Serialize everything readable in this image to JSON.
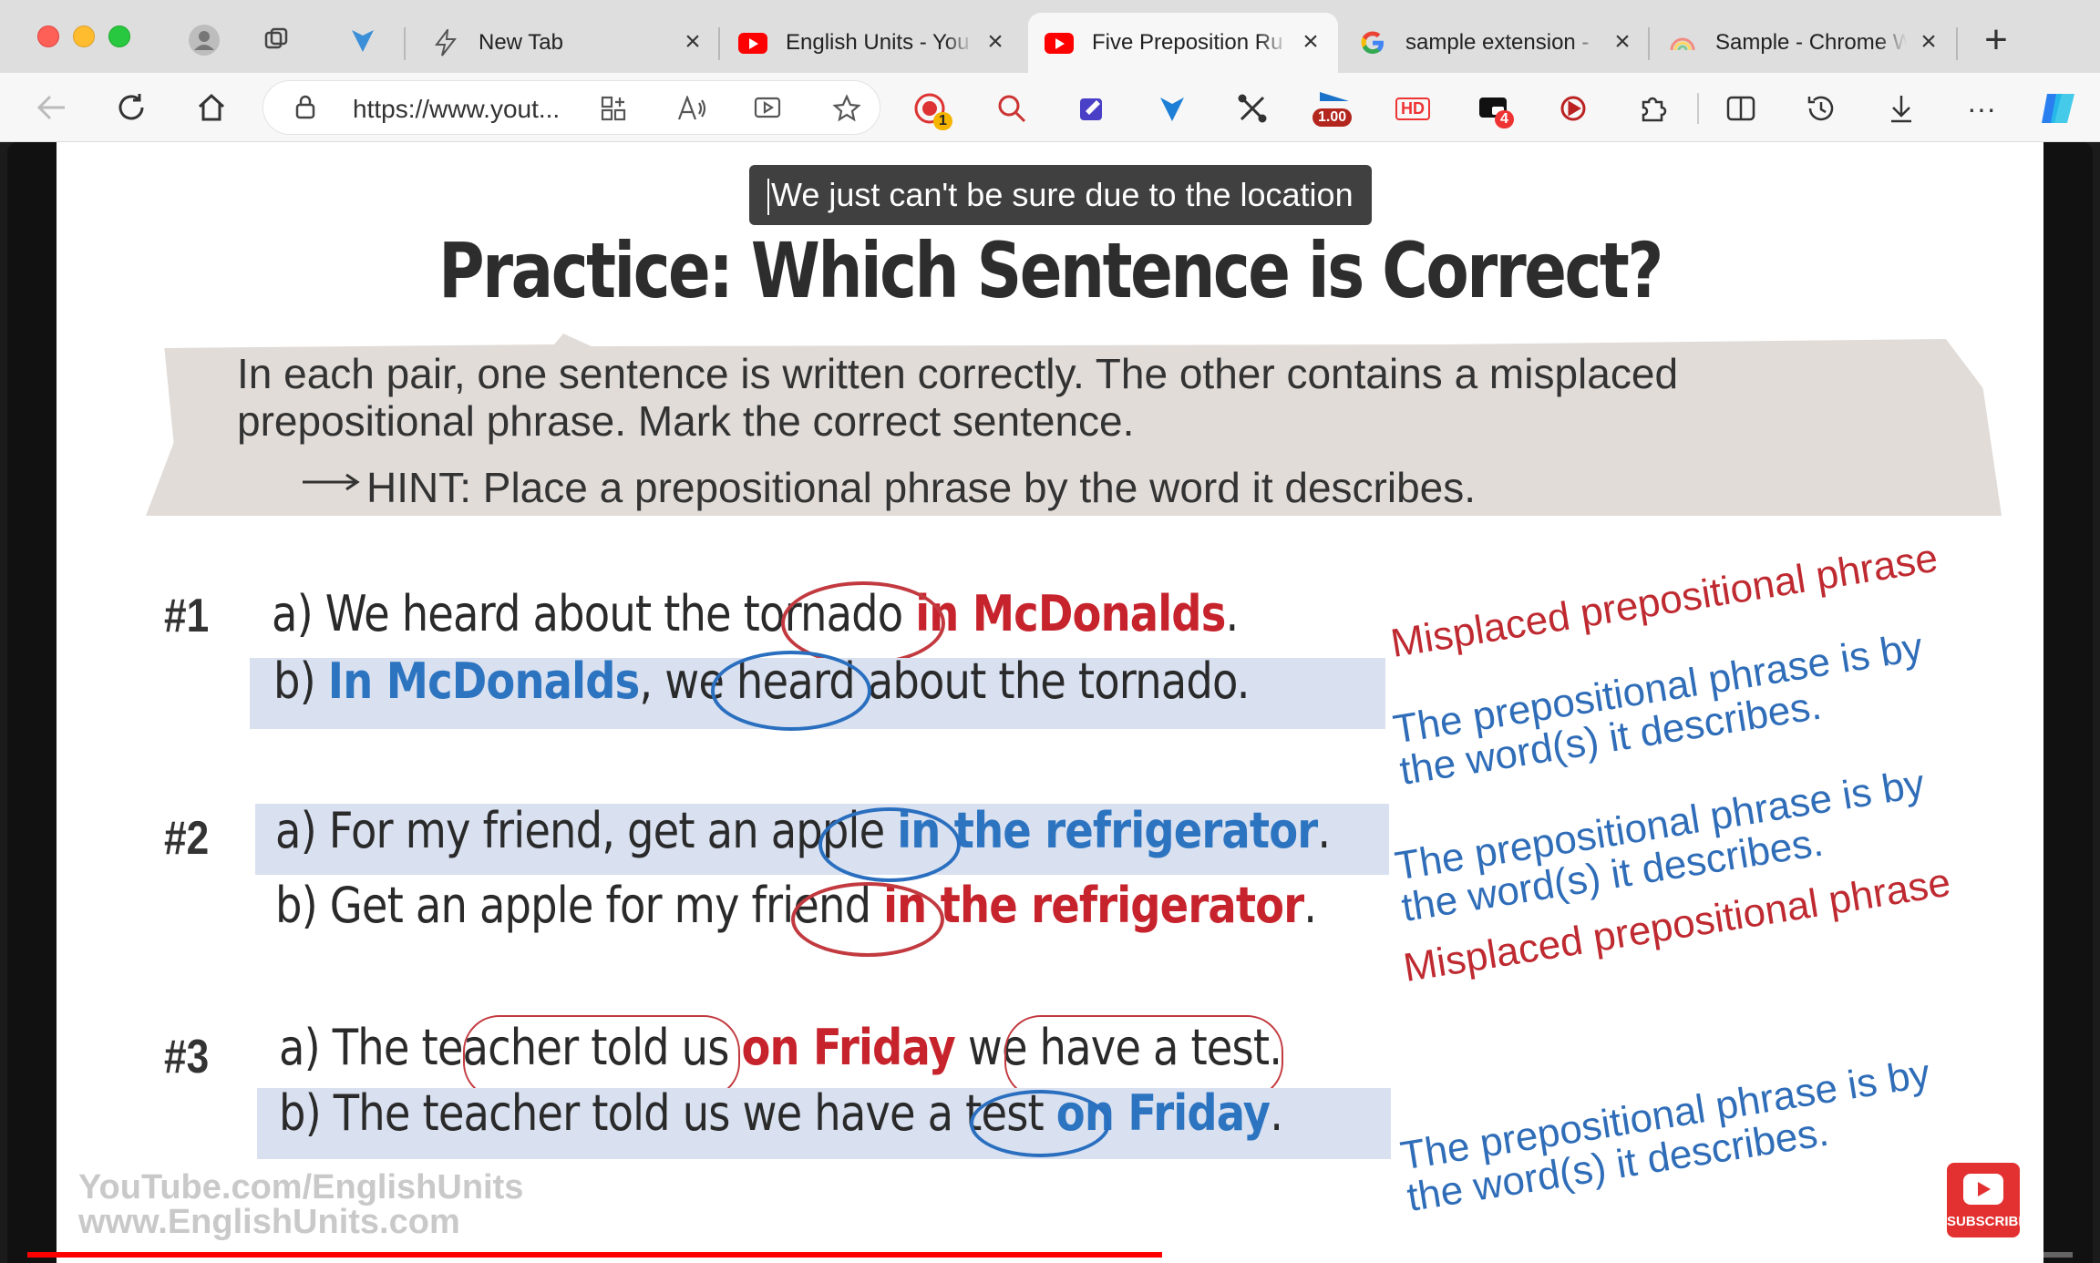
{
  "tabs": [
    {
      "title": "New Tab",
      "icon": "bolt-icon",
      "active": false
    },
    {
      "title": "English Units - You",
      "icon": "youtube-icon",
      "active": false
    },
    {
      "title": "Five Preposition Ru",
      "icon": "youtube-icon",
      "active": true
    },
    {
      "title": "sample extension -",
      "icon": "google-icon",
      "active": false
    },
    {
      "title": "Sample - Chrome W",
      "icon": "rainbow-icon",
      "active": false
    }
  ],
  "address_bar": {
    "url": "https://www.yout..."
  },
  "extensions": {
    "badge_1": "1",
    "zoom_badge": "1.00",
    "hd_label": "HD",
    "badge_4": "4"
  },
  "video": {
    "caption": "We just can't be sure due to the location",
    "progress": 0.555,
    "title": "Practice: Which Sentence is Correct?",
    "instructions": "In each pair, one sentence is written correctly. The other contains a misplaced prepositional phrase. Mark the correct sentence.",
    "hint": "HINT: Place a prepositional phrase by the word it describes.",
    "questions": [
      {
        "number": "#1",
        "a": {
          "label": "a)",
          "before": "We heard about the tornado",
          "phrase": "in McDonalds",
          "after": "."
        },
        "b": {
          "label": "b)",
          "phrase": "In McDonalds",
          "after": ", we heard about the tornado."
        },
        "note_a": "Misplaced prepositional phrase",
        "note_b": "The prepositional phrase is by the word(s) it describes."
      },
      {
        "number": "#2",
        "a": {
          "label": "a)",
          "before": "For my friend, get an apple",
          "phrase": "in the refrigerator",
          "after": "."
        },
        "b": {
          "label": "b)",
          "before": "Get an apple for my friend",
          "phrase": "in the refrigerator",
          "after": "."
        },
        "note_a": "The prepositional phrase is by the word(s) it describes.",
        "note_b": "Misplaced prepositional phrase"
      },
      {
        "number": "#3",
        "a": {
          "label": "a)",
          "before": "The teacher told us",
          "phrase": "on Friday",
          "after": "we have a test."
        },
        "b": {
          "label": "b)",
          "before": "The teacher told us we have a test",
          "phrase": "on Friday",
          "after": "."
        },
        "note_b": "The prepositional phrase is by the word(s) it describes."
      }
    ],
    "watermark_line1": "YouTube.com/EnglishUnits",
    "watermark_line2": "www.EnglishUnits.com",
    "subscribe_label": "SUBSCRIBE"
  },
  "colors": {
    "correct_blue": "#2d74c0",
    "misplaced_red": "#c6232c",
    "highlight": "#d9e1f1"
  }
}
